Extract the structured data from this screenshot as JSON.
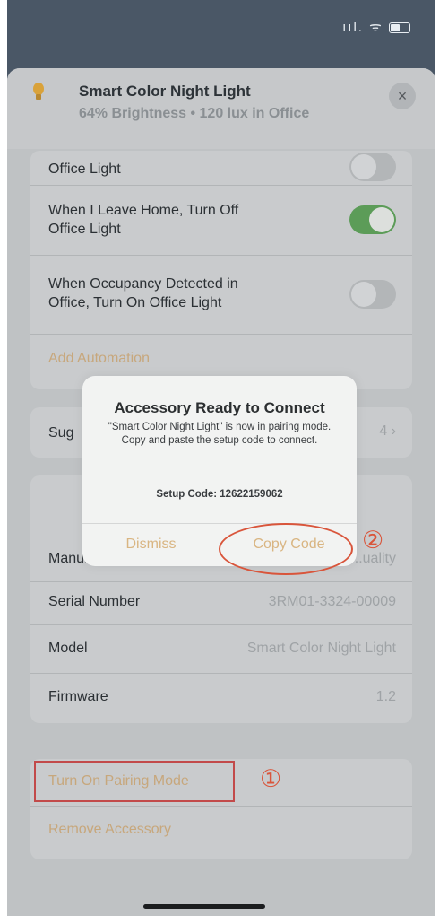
{
  "status_bar": {
    "signal_text": "ııl.",
    "wifi_text": "ᯤ"
  },
  "header": {
    "title": "Smart Color Night Light",
    "subtitle": "64% Brightness • 120 lux in Office",
    "close_label": "×"
  },
  "automations": {
    "rows": [
      {
        "label": "Office Light",
        "toggle_on": false
      },
      {
        "label_line1": "When I Leave Home, Turn Off",
        "label_line2": "Office Light",
        "toggle_on": true
      },
      {
        "label_line1": "When Occupancy Detected in",
        "label_line2": "Office, Turn On Office Light",
        "toggle_on": false
      }
    ],
    "add_label": "Add Automation"
  },
  "suggestions": {
    "label": "Sug",
    "value": "4 ›"
  },
  "info": {
    "rows": [
      {
        "label": "Manufacturer",
        "value": "...uality"
      },
      {
        "label": "Serial Number",
        "value": "3RM01-3324-00009"
      },
      {
        "label": "Model",
        "value": "Smart Color Night Light"
      },
      {
        "label": "Firmware",
        "value": "1.2"
      }
    ]
  },
  "actions": {
    "pairing_label": "Turn On Pairing Mode",
    "remove_label": "Remove Accessory"
  },
  "dialog": {
    "title": "Accessory Ready to Connect",
    "message": "\"Smart Color Night Light\" is now in pairing mode. Copy and paste the setup code to connect.",
    "setup_code": "Setup Code: 12622159062",
    "dismiss_label": "Dismiss",
    "copy_label": "Copy Code"
  },
  "callouts": {
    "one": "①",
    "two": "②"
  },
  "colors": {
    "accent": "#d9b582",
    "toggle_on": "#5c9c58",
    "annotation": "#d9553b"
  }
}
